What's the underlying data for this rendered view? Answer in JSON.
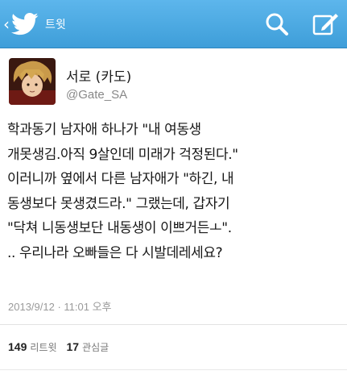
{
  "topbar": {
    "back_icon": "chevron-left",
    "logo_icon": "twitter-bird",
    "title": "트윗",
    "search_icon": "search",
    "compose_icon": "compose",
    "color": "#4aa8e3"
  },
  "tweet": {
    "avatar_icon": "user-avatar",
    "display_name": "서로 (카도)",
    "handle": "@Gate_SA",
    "text_lines": [
      "학과동기 남자애 하나가 \"내 여동생",
      "개못생김.아직 9살인데 미래가 걱정된다.\"",
      "이러니까 옆에서 다른 남자애가 \"하긴, 내",
      "동생보다 못생겼드라.\" 그랬는데, 갑자기",
      "\"닥쳐  니동생보단 내동생이 이쁘거든ㅗ\".",
      "..  우리나라 오빠들은 다 시발데레세요?"
    ],
    "timestamp": "2013/9/12 · 11:01 오후"
  },
  "stats": {
    "retweets_count": "149",
    "retweets_label": "리트윗",
    "favorites_count": "17",
    "favorites_label": "관심글"
  }
}
